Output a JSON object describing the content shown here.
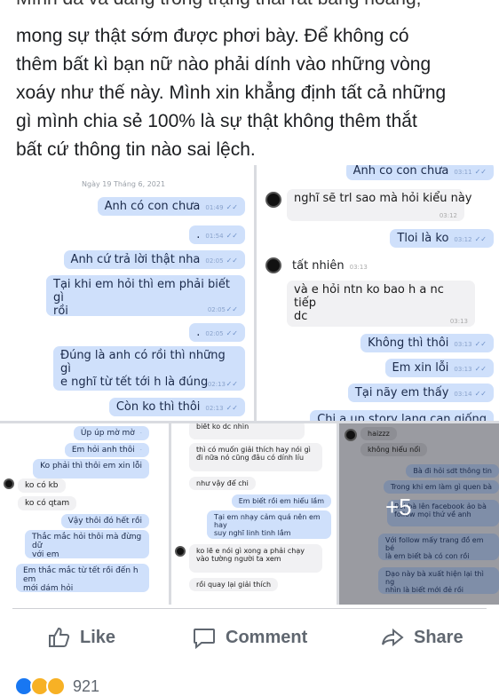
{
  "post": {
    "cut_line": "Mình đã và đang trong trạng thái rất bàng hoàng,",
    "lines": [
      "mong sự thật sớm được phơi bày. Để không có",
      "thêm bất kì bạn nữ nào phải dính vào những vòng",
      "xoáy như thế này. Mình xin khẳng định tất cả những",
      "gì mình chia sẻ 100% là sự thật không thêm thắt",
      "bất cứ thông tin nào sai lệch."
    ]
  },
  "chat1": {
    "date": "Ngày 19 Tháng 6, 2021",
    "messages": [
      {
        "text": "Anh có con chưa",
        "time": "01:49"
      },
      {
        "text": ".",
        "time": "01:54"
      },
      {
        "text": "Anh cứ trả lời thật nha",
        "time": "02:05"
      },
      {
        "text": "Tại khi em hỏi thì em phải biết gì",
        "text2": "rồi",
        "time": "02:05"
      },
      {
        "text": ".",
        "time": "02:05"
      },
      {
        "text": "Đúng là anh có rồi thì những gì",
        "text2": "e nghĩ từ tết tới h là đúng",
        "time": "02:13"
      },
      {
        "text": "Còn ko thì thôi",
        "time": "02:13"
      }
    ]
  },
  "chat2": {
    "messages": [
      {
        "text": "Anh co con chưa",
        "time": "03:11"
      },
      {
        "text": "nghĩ sẽ trl sao mà hỏi kiểu này",
        "time": "03:12"
      },
      {
        "text": "Tloi là ko",
        "time": "03:12"
      },
      {
        "text": "tất nhiên",
        "time": "03:13"
      },
      {
        "text": "và e hỏi ntn ko bao h a nc tiếp",
        "text2": "dc",
        "time": "03:13"
      },
      {
        "text": "Không thì thôi",
        "time": "03:13"
      },
      {
        "text": "Em xin lỗi",
        "time": "03:13"
      },
      {
        "text": "Tại nãy em thấy",
        "time": "03:14"
      },
      {
        "text": "Chị ạ up story lang can giống",
        "time": ""
      }
    ]
  },
  "chat3": {
    "messages": [
      {
        "text": "Úp úp mờ mờ"
      },
      {
        "text": "Em hỏi anh thôi"
      },
      {
        "text": "Ko phải thì thôi em xin lỗi"
      },
      {
        "text": "ko có kb"
      },
      {
        "text": "ko có qtam"
      },
      {
        "text": "Vậy thôi đó hết rồi"
      },
      {
        "text": "Thắc mắc hỏi thôi mà đừng dữ",
        "text2": "với em"
      },
      {
        "text": "Em thắc mắc từ tết rồi đến h em",
        "text2": "mới dám hỏi"
      }
    ]
  },
  "chat4": {
    "messages": [
      {
        "text": "biết ko dc nhìn"
      },
      {
        "text": "thì có muốn giải thích hay nói gì",
        "text2": "đi nữa nó cũng đâu có dính líu"
      },
      {
        "text": "như vậy để chi"
      },
      {
        "text": "Em biết rồi em hiểu lầm"
      },
      {
        "text": "Tại em nhạy cảm quá nên em hay",
        "text2": "suy nghĩ linh tinh lắm"
      },
      {
        "text": "ko lẽ e nói gì xong a phải chạy",
        "text2": "vào tường người ta xem"
      },
      {
        "text": "rồi quay lại giải thích"
      }
    ]
  },
  "chat5": {
    "messages": [
      {
        "text": "haizzz"
      },
      {
        "text": "không hiểu nổi"
      },
      {
        "text": "Bà đi hỏi sdt thông tin"
      },
      {
        "text": "Trong khi em làm gì quen bà"
      },
      {
        "text": "Rồi bà lên facebook ảo bà",
        "text2": "follow mọi thứ về anh"
      },
      {
        "text": "Với follow mấy trang đồ em bé",
        "text2": "là em biết bà có con rồi"
      },
      {
        "text": "Dạo này bà xuất hiện lại thì ng",
        "text2": "nhìn là biết mới đẻ rồi"
      }
    ],
    "more_count": "+5"
  },
  "actions": {
    "like": "Like",
    "comment": "Comment",
    "share": "Share"
  },
  "reactions": {
    "count": "921"
  }
}
